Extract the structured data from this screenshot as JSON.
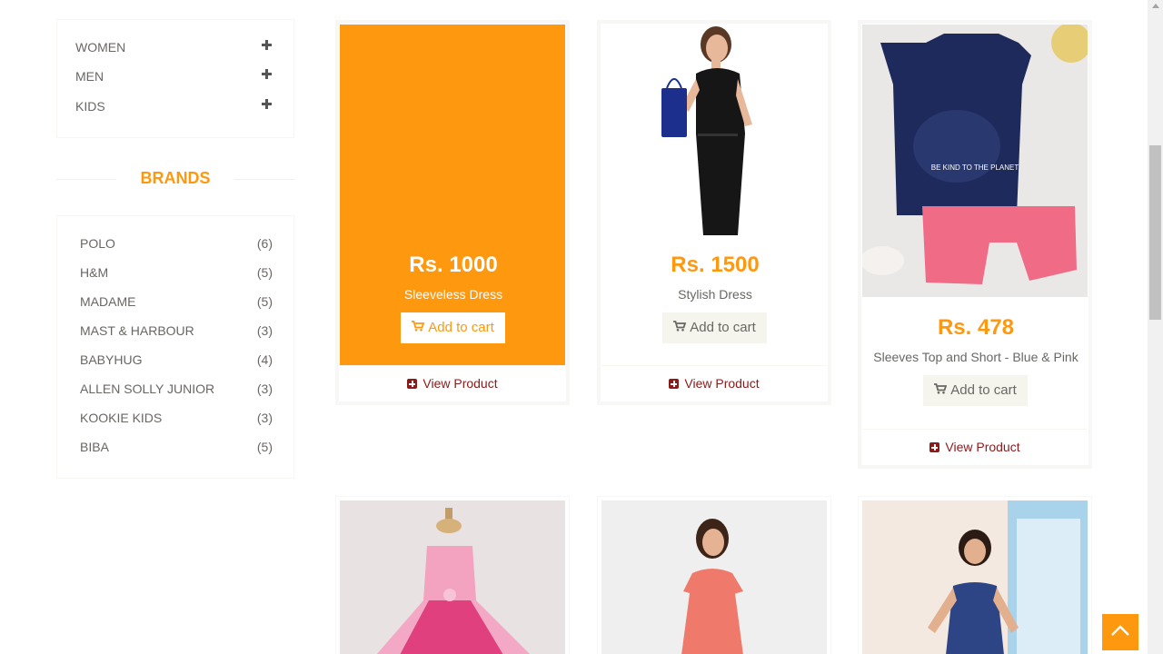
{
  "categories": [
    {
      "label": "WOMEN"
    },
    {
      "label": "MEN"
    },
    {
      "label": "KIDS"
    }
  ],
  "brands_title": "BRANDS",
  "brands": [
    {
      "name": "POLO",
      "count": "(6)"
    },
    {
      "name": "H&M",
      "count": "(5)"
    },
    {
      "name": "MADAME",
      "count": "(5)"
    },
    {
      "name": "MAST & HARBOUR",
      "count": "(3)"
    },
    {
      "name": "BABYHUG",
      "count": "(4)"
    },
    {
      "name": "ALLEN SOLLY JUNIOR",
      "count": "(3)"
    },
    {
      "name": "KOOKIE KIDS",
      "count": "(3)"
    },
    {
      "name": "BIBA",
      "count": "(5)"
    }
  ],
  "products": [
    {
      "price": "Rs. 1000",
      "name": "Sleeveless Dress",
      "add_to_cart": "Add to cart",
      "view_product": "View Product",
      "highlighted": true
    },
    {
      "price": "Rs. 1500",
      "name": "Stylish Dress",
      "add_to_cart": "Add to cart",
      "view_product": "View Product"
    },
    {
      "price": "Rs. 478",
      "name": "Sleeves Top and Short - Blue & Pink",
      "add_to_cart": "Add to cart",
      "view_product": "View Product"
    }
  ],
  "colors": {
    "accent": "#fe980f",
    "view_product": "#8b1a1a"
  },
  "icons": {
    "cart": "shopping-cart-icon",
    "plus": "plus-icon",
    "scroll_top": "chevron-up-icon"
  }
}
